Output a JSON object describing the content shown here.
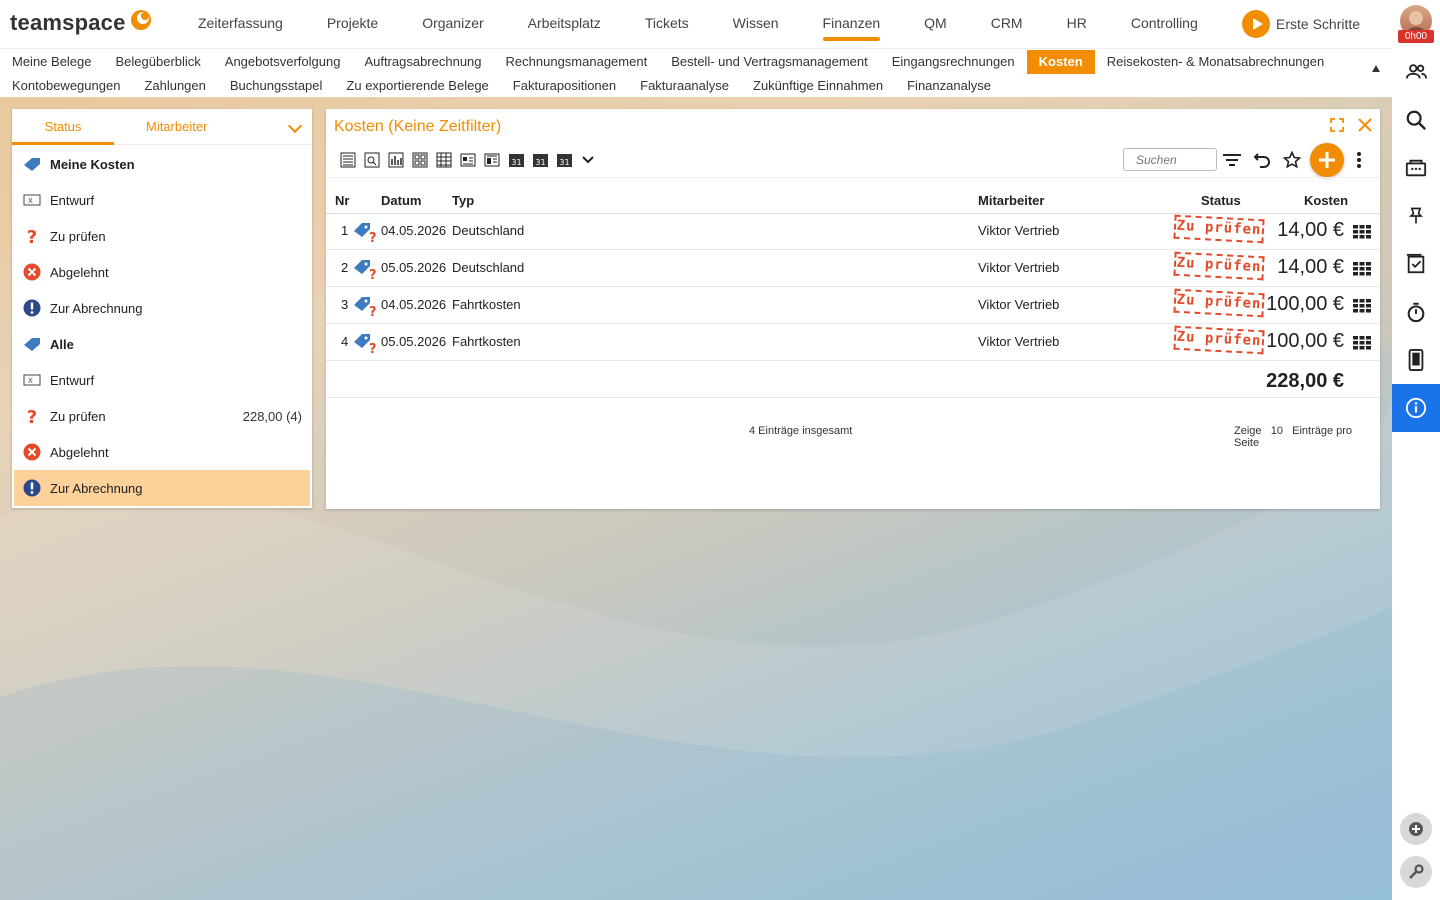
{
  "app": {
    "logo": "teamspace",
    "time_badge": "0h00",
    "first_steps": "Erste Schritte"
  },
  "main_nav": [
    "Zeiterfassung",
    "Projekte",
    "Organizer",
    "Arbeitsplatz",
    "Tickets",
    "Wissen",
    "Finanzen",
    "QM",
    "CRM",
    "HR",
    "Controlling"
  ],
  "main_nav_active": "Finanzen",
  "sub_nav": {
    "row1": [
      "Meine Belege",
      "Belegüberblick",
      "Angebotsverfolgung",
      "Auftragsabrechnung",
      "Rechnungsmanagement",
      "Bestell- und Vertragsmanagement",
      "Eingangsrechnungen",
      "Kosten",
      "Reisekosten- & Monatsabrechnungen"
    ],
    "row2": [
      "Kontobewegungen",
      "Zahlungen",
      "Buchungsstapel",
      "Zu exportierende Belege",
      "Fakturapositionen",
      "Fakturaanalyse",
      "Zukünftige Einnahmen",
      "Finanzanalyse"
    ],
    "active": "Kosten"
  },
  "left_panel": {
    "tabs": [
      "Status",
      "Mitarbeiter"
    ],
    "items": [
      {
        "label": "Meine Kosten",
        "icon": "tag-icon",
        "bold": true,
        "value": ""
      },
      {
        "label": "Entwurf",
        "icon": "draft-icon",
        "bold": false,
        "value": ""
      },
      {
        "label": "Zu prüfen",
        "icon": "question-icon",
        "bold": false,
        "value": ""
      },
      {
        "label": "Abgelehnt",
        "icon": "rejected-icon",
        "bold": false,
        "value": ""
      },
      {
        "label": "Zur Abrechnung",
        "icon": "exclamation-icon",
        "bold": false,
        "value": ""
      },
      {
        "label": "Alle",
        "icon": "tag-icon",
        "bold": true,
        "value": ""
      },
      {
        "label": "Entwurf",
        "icon": "draft-icon",
        "bold": false,
        "value": ""
      },
      {
        "label": "Zu prüfen",
        "icon": "question-icon",
        "bold": false,
        "value": "228,00 (4)"
      },
      {
        "label": "Abgelehnt",
        "icon": "rejected-icon",
        "bold": false,
        "value": ""
      },
      {
        "label": "Zur Abrechnung",
        "icon": "exclamation-icon",
        "bold": false,
        "value": ""
      }
    ],
    "selected_index": 9
  },
  "main_panel": {
    "title": "Kosten (Keine Zeitfilter)",
    "search_placeholder": "Suchen",
    "columns": {
      "nr": "Nr",
      "datum": "Datum",
      "typ": "Typ",
      "mitarbeiter": "Mitarbeiter",
      "status": "Status",
      "kosten": "Kosten"
    },
    "rows": [
      {
        "nr": "1",
        "datum": "04.05.2026",
        "typ": "Deutschland",
        "mitarbeiter": "Viktor Vertrieb",
        "status": "Zu prüfen",
        "kosten": "14,00 €"
      },
      {
        "nr": "2",
        "datum": "05.05.2026",
        "typ": "Deutschland",
        "mitarbeiter": "Viktor Vertrieb",
        "status": "Zu prüfen",
        "kosten": "14,00 €"
      },
      {
        "nr": "3",
        "datum": "04.05.2026",
        "typ": "Fahrtkosten",
        "mitarbeiter": "Viktor Vertrieb",
        "status": "Zu prüfen",
        "kosten": "100,00 €"
      },
      {
        "nr": "4",
        "datum": "05.05.2026",
        "typ": "Fahrtkosten",
        "mitarbeiter": "Viktor Vertrieb",
        "status": "Zu prüfen",
        "kosten": "100,00 €"
      }
    ],
    "total": "228,00 €",
    "footer_total": "4 Einträge insgesamt",
    "footer_page_prefix": "Zeige",
    "footer_page_size": "10",
    "footer_page_suffix": "Einträge pro Seite"
  },
  "colors": {
    "accent": "#f28c00",
    "active_sidebar": "#1a73e8",
    "stamp": "#e34b2a",
    "selection": "#fdd19a"
  }
}
